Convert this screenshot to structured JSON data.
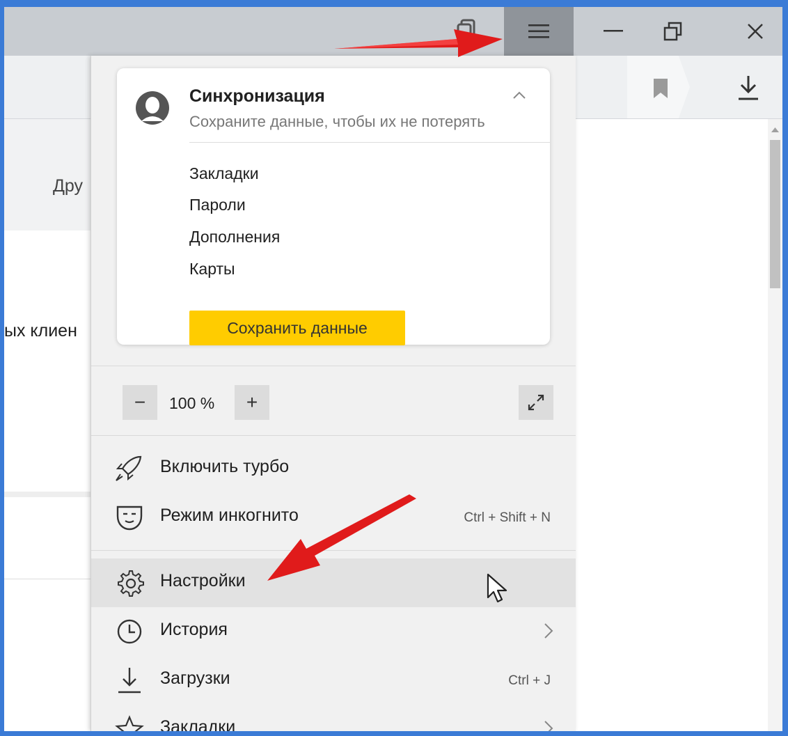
{
  "window": {
    "minimize_glyph": "—",
    "restore_glyph": "🗗",
    "close_glyph": "✕"
  },
  "page": {
    "left_top_text": "Дру",
    "left_mid_text": "ых клиен"
  },
  "sync": {
    "title": "Синхронизация",
    "subtitle": "Сохраните данные, чтобы их не потерять",
    "items": [
      "Закладки",
      "Пароли",
      "Дополнения",
      "Карты"
    ],
    "save_button": "Сохранить данные"
  },
  "zoom": {
    "minus": "−",
    "value": "100 %",
    "plus": "+"
  },
  "menu": {
    "turbo": "Включить турбо",
    "incognito": "Режим инкогнито",
    "incognito_shortcut": "Ctrl + Shift + N",
    "settings": "Настройки",
    "history": "История",
    "downloads": "Загрузки",
    "downloads_shortcut": "Ctrl + J",
    "bookmarks": "Закладки"
  },
  "colors": {
    "save_button": "#ffcc00",
    "annotation_arrow": "#e01b1b",
    "window_border": "#3b7bd6"
  }
}
